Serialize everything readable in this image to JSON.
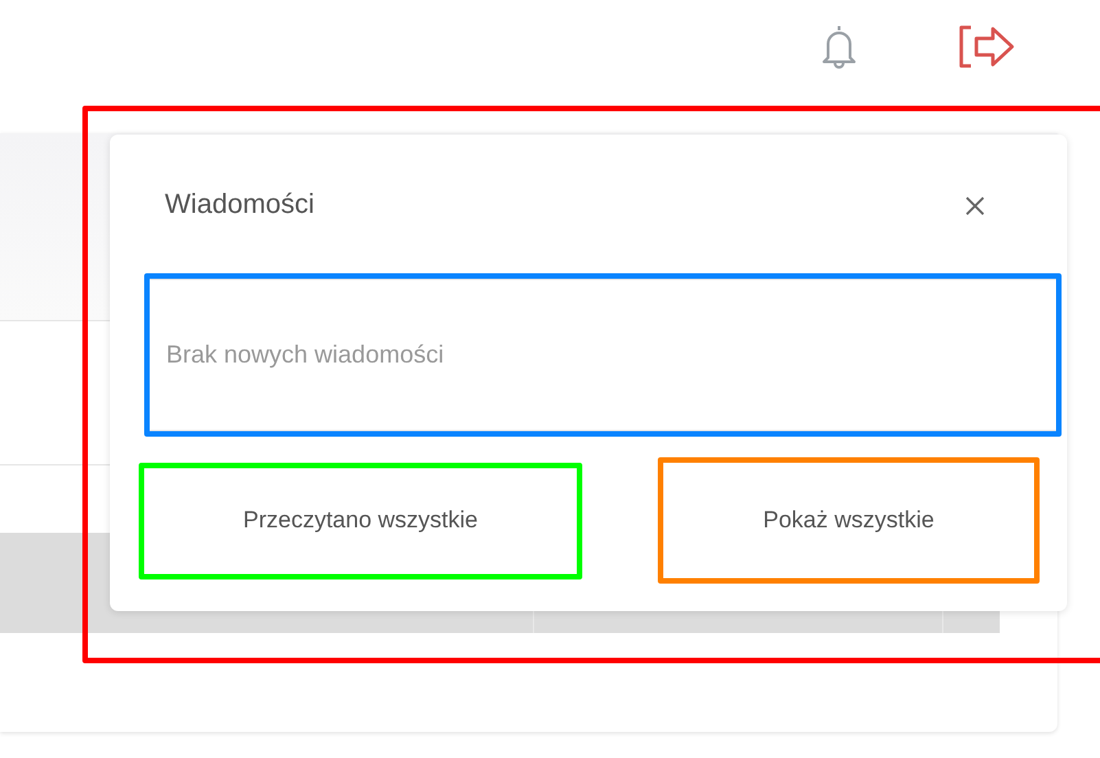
{
  "popup": {
    "title": "Wiadomości",
    "color": "#ff0000",
    "message": {
      "text": "Brak nowych wiadomości",
      "color": "#0a84ff"
    },
    "buttons": [
      {
        "label": "Przeczytano wszystkie",
        "color": "#00ff00"
      },
      {
        "label": "Pokaż wszystkie",
        "color": "#ff8000"
      }
    ]
  }
}
